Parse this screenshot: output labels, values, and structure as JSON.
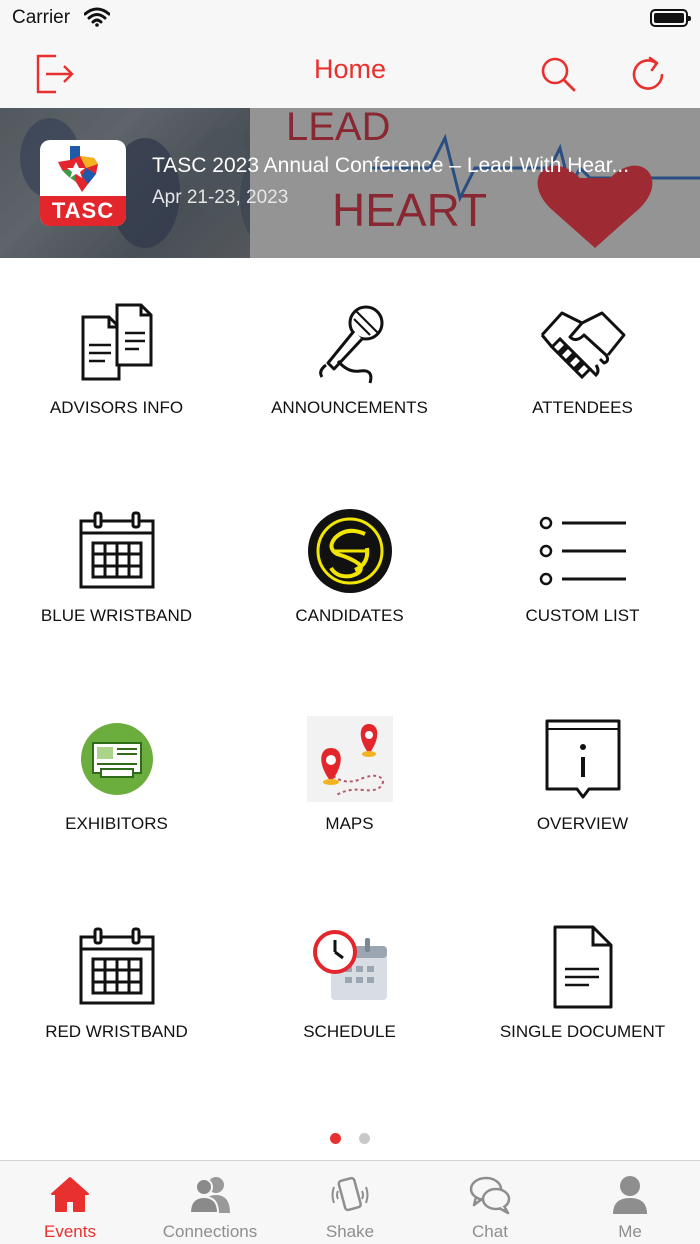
{
  "status_bar": {
    "carrier": "Carrier"
  },
  "nav": {
    "title": "Home",
    "logout_icon": "logout-icon",
    "search_icon": "search-icon",
    "refresh_icon": "refresh-icon",
    "accent_color": "#e8302f"
  },
  "banner": {
    "logo_text": "TASC",
    "title": "TASC 2023 Annual Conference – Lead With Hear...",
    "date": "Apr 21-23, 2023",
    "art_text_top": "LEAD",
    "art_text_bottom": "HEART"
  },
  "grid": {
    "items": [
      {
        "label": "ADVISORS INFO",
        "icon": "documents-icon"
      },
      {
        "label": "ANNOUNCEMENTS",
        "icon": "microphone-icon"
      },
      {
        "label": "ATTENDEES",
        "icon": "handshake-icon"
      },
      {
        "label": "BLUE WRISTBAND",
        "icon": "calendar-icon"
      },
      {
        "label": "CANDIDATES",
        "icon": "candidates-logo-icon"
      },
      {
        "label": "CUSTOM LIST",
        "icon": "list-icon"
      },
      {
        "label": "EXHIBITORS",
        "icon": "exhibitor-booth-icon"
      },
      {
        "label": "MAPS",
        "icon": "map-pins-icon"
      },
      {
        "label": "OVERVIEW",
        "icon": "info-icon"
      },
      {
        "label": "RED WRISTBAND",
        "icon": "calendar-icon"
      },
      {
        "label": "SCHEDULE",
        "icon": "schedule-clock-icon"
      },
      {
        "label": "SINGLE DOCUMENT",
        "icon": "document-icon"
      }
    ]
  },
  "pager": {
    "pages": 2,
    "current": 1
  },
  "tab_bar": {
    "tabs": [
      {
        "label": "Events",
        "icon": "home-icon",
        "active": true
      },
      {
        "label": "Connections",
        "icon": "people-icon",
        "active": false
      },
      {
        "label": "Shake",
        "icon": "shake-phone-icon",
        "active": false
      },
      {
        "label": "Chat",
        "icon": "chat-bubbles-icon",
        "active": false
      },
      {
        "label": "Me",
        "icon": "person-icon",
        "active": false
      }
    ]
  }
}
